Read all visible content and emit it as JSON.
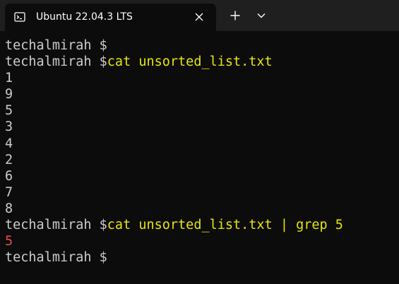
{
  "window": {
    "tab_title": "Ubuntu 22.04.3 LTS",
    "icons": {
      "tab": "terminal-icon",
      "close": "close-icon",
      "new_tab": "plus-icon",
      "dropdown": "chevron-down-icon"
    }
  },
  "colors": {
    "background": "#0c0c0c",
    "titlebar": "#1f1f1f",
    "text": "#cccccc",
    "command": "#e5e510",
    "match": "#e74856"
  },
  "terminal": {
    "prompt_1": "techalmirah $",
    "prompt_2": "techalmirah $",
    "command_2": "cat unsorted_list.txt",
    "output": [
      "1",
      "9",
      "5",
      "3",
      "4",
      "2",
      "6",
      "7",
      "8"
    ],
    "prompt_3": "techalmirah $",
    "command_3": "cat unsorted_list.txt | grep 5",
    "grep_result": "5",
    "prompt_4": "techalmirah $"
  }
}
